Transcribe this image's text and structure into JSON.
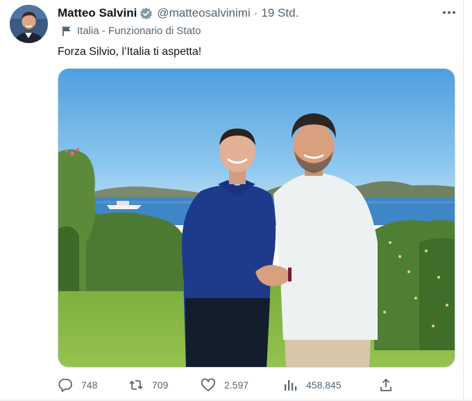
{
  "tweet": {
    "author_name": "Matteo Salvini",
    "handle": "@matteosalvinimi",
    "separator": "·",
    "time": "19 Std.",
    "affiliation_label": "Italia - Funzionario di Stato",
    "text": "Forza Silvio, l’Italia ti aspetta!",
    "more_icon": "more-horizontal-icon",
    "verified_icon": "verified-badge-icon",
    "label_icon": "flag-icon"
  },
  "metrics": {
    "replies": "748",
    "retweets": "709",
    "likes": "2.597",
    "views": "458.845"
  },
  "colors": {
    "text": "#0f1419",
    "secondary": "#536471",
    "verified_badge": "#829aab",
    "border": "#cfd9de"
  }
}
